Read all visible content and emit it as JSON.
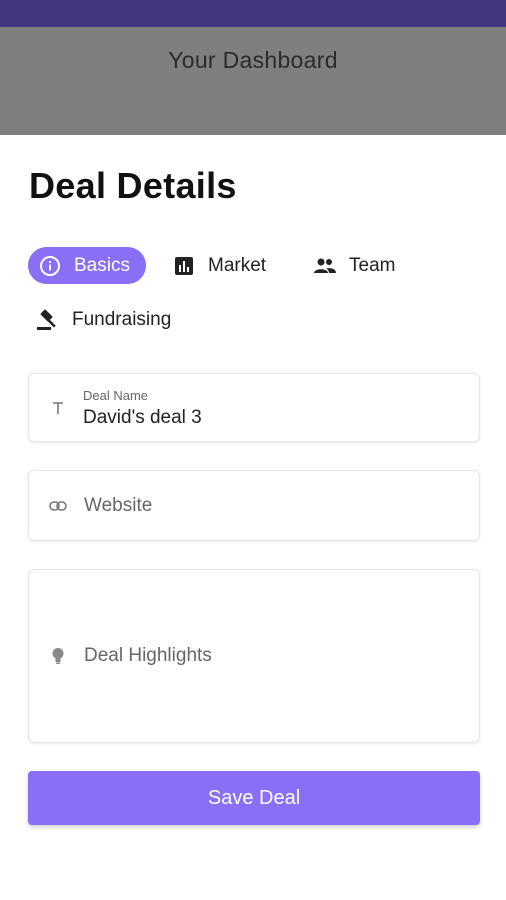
{
  "header": {
    "title": "Your Dashboard"
  },
  "page": {
    "title": "Deal Details"
  },
  "tabs": [
    {
      "label": "Basics",
      "icon": "info-icon",
      "active": true
    },
    {
      "label": "Market",
      "icon": "bar-chart-icon",
      "active": false
    },
    {
      "label": "Team",
      "icon": "people-icon",
      "active": false
    },
    {
      "label": "Fundraising",
      "icon": "gavel-icon",
      "active": false
    }
  ],
  "form": {
    "deal_name": {
      "label": "Deal Name",
      "value": "David's deal 3",
      "icon": "text-icon"
    },
    "website": {
      "placeholder": "Website",
      "icon": "link-icon"
    },
    "highlights": {
      "placeholder": "Deal Highlights",
      "icon": "lightbulb-icon"
    },
    "save_label": "Save Deal"
  },
  "colors": {
    "accent": "#8b6ef6",
    "status_bar": "#43367f",
    "header_overlay": "#7f7f7f"
  }
}
